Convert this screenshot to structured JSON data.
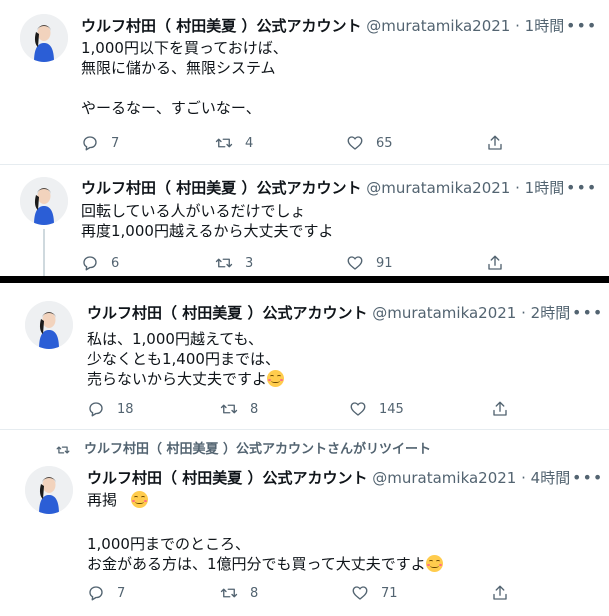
{
  "tweets": [
    {
      "name": "ウルフ村田（ 村田美夏 ）公式アカウント",
      "meta": "@muratamika2021 · 1時間",
      "lines": [
        "1,000円以下を買っておけば、",
        "無限に儲かる、無限システム",
        "",
        "やーるなー、すごいなー、"
      ],
      "reply": "7",
      "retweet": "4",
      "like": "65"
    },
    {
      "name": "ウルフ村田（ 村田美夏 ）公式アカウント",
      "meta": "@muratamika2021 · 1時間",
      "lines": [
        "回転している人がいるだけでしょ",
        "再度1,000円越えるから大丈夫ですよ"
      ],
      "reply": "6",
      "retweet": "3",
      "like": "91"
    },
    {
      "name": "ウルフ村田（ 村田美夏 ）公式アカウント",
      "meta": "@muratamika2021 · 2時間",
      "lines": [
        "私は、1,000円越えても、",
        "少なくとも1,400円までは、",
        "売らないから大丈夫ですよ"
      ],
      "reply": "18",
      "retweet": "8",
      "like": "145"
    },
    {
      "retweeted_by": "ウルフ村田（ 村田美夏 ）公式アカウントさんがリツイート",
      "name": "ウルフ村田（ 村田美夏 ）公式アカウント",
      "meta": "@muratamika2021 · 4時間",
      "lines": [
        "再掲",
        "",
        "1,000円までのところ、",
        "お金がある方は、1億円分でも買って大丈夫ですよ"
      ],
      "reply": "7",
      "retweet": "8",
      "like": "71"
    }
  ],
  "colors": {
    "secondary_text": "#536471",
    "border": "#e6ecf0",
    "emoji": "#ffcc4d"
  },
  "icons": [
    "more-icon",
    "reply-icon",
    "retweet-icon",
    "like-icon",
    "share-icon",
    "emoji-smiling-face"
  ]
}
